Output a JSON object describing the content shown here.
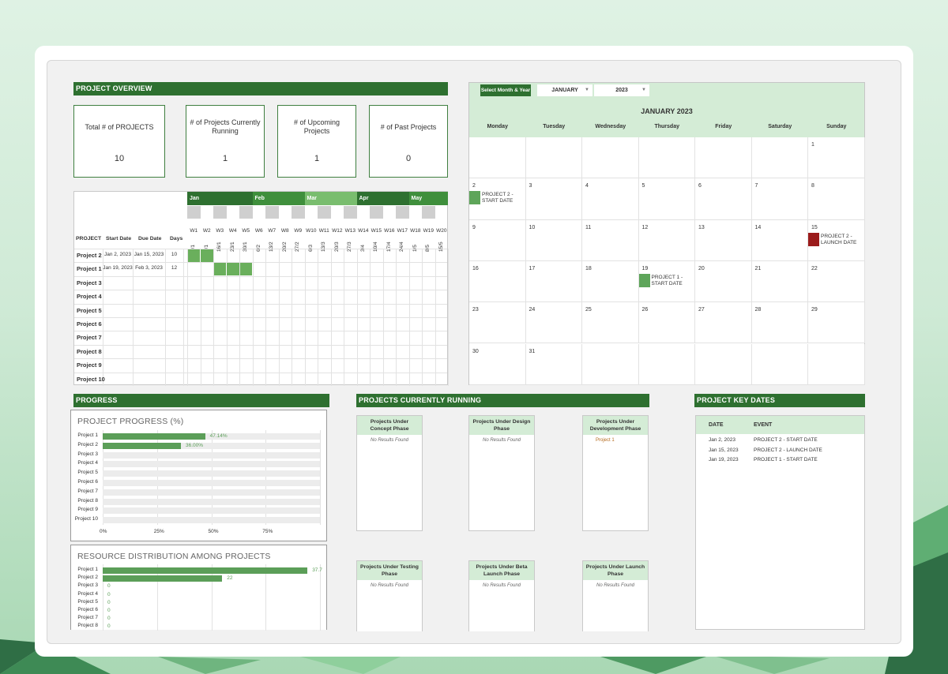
{
  "overview": {
    "header": "PROJECT OVERVIEW",
    "kpis": [
      {
        "label": "Total # of PROJECTS",
        "value": "10"
      },
      {
        "label": "# of Projects Currently Running",
        "value": "1"
      },
      {
        "label": "# of Upcoming Projects",
        "value": "1"
      },
      {
        "label": "# of Past Projects",
        "value": "0"
      }
    ]
  },
  "gantt": {
    "col_project": "PROJECT",
    "col_start": "Start Date",
    "col_due": "Due Date",
    "col_days": "Days",
    "months": [
      {
        "label": "Jan",
        "color": "#2e7030"
      },
      {
        "label": "Feb",
        "color": "#3f8f3c"
      },
      {
        "label": "Mar",
        "color": "#79bd6e"
      },
      {
        "label": "Apr",
        "color": "#2e7030"
      },
      {
        "label": "May",
        "color": "#3f8f3c"
      }
    ],
    "weeks": [
      "W1",
      "W2",
      "W3",
      "W4",
      "W5",
      "W6",
      "W7",
      "W8",
      "W9",
      "W10",
      "W11",
      "W12",
      "W13",
      "W14",
      "W15",
      "W16",
      "W17",
      "W18",
      "W19",
      "W20"
    ],
    "week_dates": [
      "2/1",
      "9/1",
      "16/1",
      "23/1",
      "30/1",
      "6/2",
      "13/2",
      "20/2",
      "27/2",
      "6/3",
      "13/3",
      "20/3",
      "27/3",
      "3/4",
      "10/4",
      "17/4",
      "24/4",
      "1/5",
      "8/5",
      "15/5"
    ],
    "rows": [
      {
        "project": "Project 2",
        "start": "Jan 2, 2023",
        "due": "Jan 15, 2023",
        "days": "10",
        "bar_weeks": [
          1,
          2
        ]
      },
      {
        "project": "Project 1",
        "start": "Jan 19, 2023",
        "due": "Feb 3, 2023",
        "days": "12",
        "bar_weeks": [
          3,
          4,
          5
        ]
      },
      {
        "project": "Project 3",
        "start": "",
        "due": "",
        "days": "",
        "bar_weeks": []
      },
      {
        "project": "Project 4",
        "start": "",
        "due": "",
        "days": "",
        "bar_weeks": []
      },
      {
        "project": "Project 5",
        "start": "",
        "due": "",
        "days": "",
        "bar_weeks": []
      },
      {
        "project": "Project 6",
        "start": "",
        "due": "",
        "days": "",
        "bar_weeks": []
      },
      {
        "project": "Project 7",
        "start": "",
        "due": "",
        "days": "",
        "bar_weeks": []
      },
      {
        "project": "Project 8",
        "start": "",
        "due": "",
        "days": "",
        "bar_weeks": []
      },
      {
        "project": "Project 9",
        "start": "",
        "due": "",
        "days": "",
        "bar_weeks": []
      },
      {
        "project": "Project 10",
        "start": "",
        "due": "",
        "days": "",
        "bar_weeks": []
      }
    ],
    "bar_color": "#6aaf5c"
  },
  "calendar": {
    "select_label": "Select Month & Year",
    "month_value": "JANUARY",
    "year_value": "2023",
    "title": "JANUARY 2023",
    "days_of_week": [
      "Monday",
      "Tuesday",
      "Wednesday",
      "Thursday",
      "Friday",
      "Saturday",
      "Sunday"
    ],
    "weeks": [
      [
        "",
        "",
        "",
        "",
        "",
        "",
        "1"
      ],
      [
        "2",
        "3",
        "4",
        "5",
        "6",
        "7",
        "8"
      ],
      [
        "9",
        "10",
        "11",
        "12",
        "13",
        "14",
        "15"
      ],
      [
        "16",
        "17",
        "18",
        "19",
        "20",
        "21",
        "22"
      ],
      [
        "23",
        "24",
        "25",
        "26",
        "27",
        "28",
        "29"
      ],
      [
        "30",
        "31",
        "",
        "",
        "",
        "",
        ""
      ]
    ],
    "events": [
      {
        "week": 1,
        "day": 0,
        "label_line1": "PROJECT 2 -",
        "label_line2": "START DATE",
        "color": "#5ea55a"
      },
      {
        "week": 2,
        "day": 6,
        "label_line1": "PROJECT 2 -",
        "label_line2": "LAUNCH DATE",
        "color": "#9b1b1b"
      },
      {
        "week": 3,
        "day": 3,
        "label_line1": "PROJECT 1 -",
        "label_line2": "START DATE",
        "color": "#5ea55a"
      }
    ]
  },
  "progress": {
    "header": "PROGRESS",
    "chart1": {
      "title": "PROJECT PROGRESS (%)"
    },
    "chart2": {
      "title": "RESOURCE DISTRIBUTION AMONG PROJECTS"
    }
  },
  "chart_data": [
    {
      "type": "bar",
      "title": "PROJECT PROGRESS (%)",
      "orientation": "horizontal",
      "categories": [
        "Project 1",
        "Project 2",
        "Project 3",
        "Project 4",
        "Project 5",
        "Project 6",
        "Project 7",
        "Project 8",
        "Project 9",
        "Project 10"
      ],
      "values": [
        47.14,
        36.0,
        0,
        0,
        0,
        0,
        0,
        0,
        0,
        0
      ],
      "data_labels": [
        "47.14%",
        "36.00%",
        "",
        "",
        "",
        "",
        "",
        "",
        "",
        ""
      ],
      "xticks": [
        "0%",
        "25%",
        "50%",
        "75%"
      ],
      "xlim": [
        0,
        100
      ],
      "grid": true,
      "color": "#5b9e58"
    },
    {
      "type": "bar",
      "title": "RESOURCE DISTRIBUTION AMONG PROJECTS",
      "orientation": "horizontal",
      "categories": [
        "Project 1",
        "Project 2",
        "Project 3",
        "Project 4",
        "Project 5",
        "Project 6",
        "Project 7",
        "Project 8"
      ],
      "values": [
        37.7,
        22,
        0,
        0,
        0,
        0,
        0,
        0
      ],
      "data_labels": [
        "37.7",
        "22",
        "0",
        "0",
        "0",
        "0",
        "0",
        "0"
      ],
      "xlim": [
        0,
        40
      ],
      "grid": true,
      "color": "#5b9e58"
    }
  ],
  "running": {
    "header": "PROJECTS CURRENTLY RUNNING",
    "no_results": "No Results Found",
    "phases": [
      {
        "title": "Projects Under Concept Phase",
        "items": []
      },
      {
        "title": "Projects Under Design Phase",
        "items": []
      },
      {
        "title": "Projects Under Development Phase",
        "items": [
          "Project 1"
        ]
      },
      {
        "title": "Projects Under Testing Phase",
        "items": []
      },
      {
        "title": "Projects Under Beta Launch Phase",
        "items": []
      },
      {
        "title": "Projects Under Launch Phase",
        "items": []
      }
    ]
  },
  "key_dates": {
    "header": "PROJECT KEY DATES",
    "col_date": "DATE",
    "col_event": "EVENT",
    "rows": [
      {
        "date": "Jan 2, 2023",
        "event": "PROJECT 2 - START DATE"
      },
      {
        "date": "Jan 15, 2023",
        "event": "PROJECT 2 - LAUNCH DATE"
      },
      {
        "date": "Jan 19, 2023",
        "event": "PROJECT 1 - START DATE"
      }
    ]
  }
}
